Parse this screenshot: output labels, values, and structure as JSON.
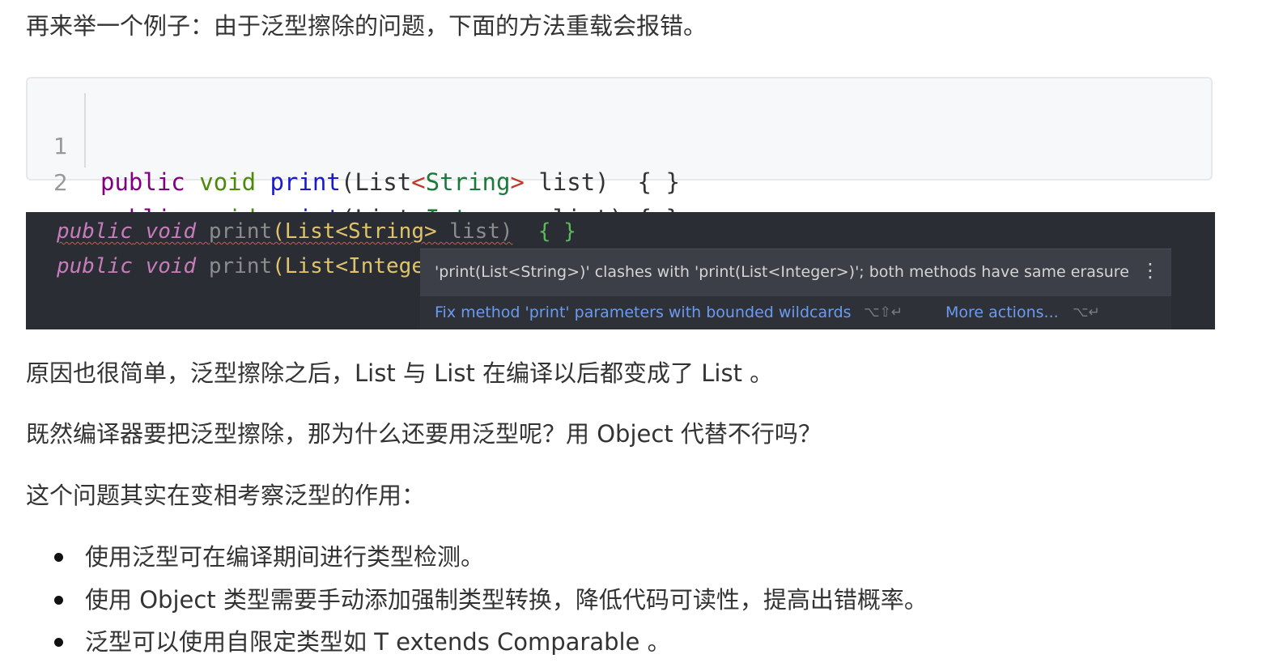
{
  "paragraphs": {
    "intro": "再来举一个例子：由于泛型擦除的问题，下面的方法重载会报错。",
    "reason": "原因也很简单，泛型擦除之后，List 与 List 在编译以后都变成了 List 。",
    "question": "既然编译器要把泛型擦除，那为什么还要用泛型呢？用 Object 代替不行吗？",
    "topic": "这个问题其实在变相考察泛型的作用："
  },
  "code_block": {
    "lines": [
      {
        "number": "1",
        "kw_public": "public",
        "kw_void": "void",
        "fn": "print",
        "paren_open": "(",
        "type_list": "List",
        "lt": "<",
        "type_arg": "String",
        "gt": ">",
        "rest": " list)  { }"
      },
      {
        "number": "2",
        "kw_public": "public",
        "kw_void": "void",
        "fn": "print",
        "paren_open": "(",
        "type_list": "List",
        "lt": "<",
        "type_arg": "Integer",
        "gt": ">",
        "rest": " list) { }"
      }
    ]
  },
  "ide": {
    "line1": {
      "kw_public": "public",
      "kw_void": "void",
      "fn": "print",
      "sig": "(List<String>",
      "arg": " list)",
      "braces": "{ }"
    },
    "line2": {
      "kw_public": "public",
      "kw_void": "void",
      "fn": "print",
      "sig": "(List<Integer"
    },
    "tooltip": {
      "message": "'print(List<String>)' clashes with 'print(List<Integer>)'; both methods have same erasure",
      "menu_glyph": "⋮",
      "fix_action": "Fix method 'print' parameters with bounded wildcards",
      "fix_shortcut": "⌥⇧↵",
      "more_action": "More actions...",
      "more_shortcut": "⌥↵"
    }
  },
  "bullets": [
    "使用泛型可在编译期间进行类型检测。",
    "使用 Object 类型需要手动添加强制类型转换，降低代码可读性，提高出错概率。",
    "泛型可以使用自限定类型如 T extends Comparable 。"
  ]
}
